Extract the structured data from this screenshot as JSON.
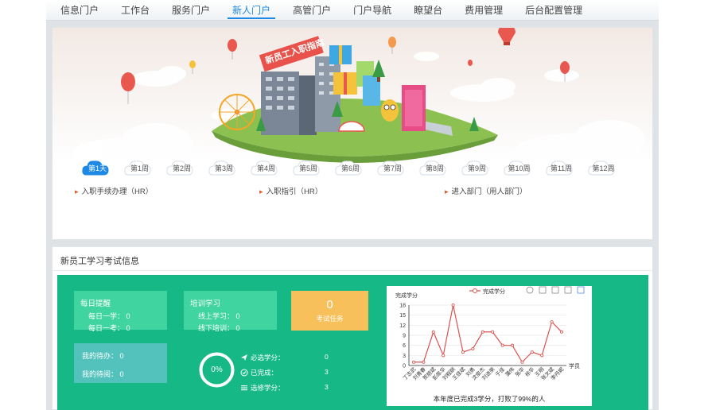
{
  "nav": {
    "items": [
      "信息门户",
      "工作台",
      "服务门户",
      "新人门户",
      "高管门户",
      "门户导航",
      "瞭望台",
      "费用管理",
      "后台配置管理"
    ],
    "active_index": 3
  },
  "banner": {
    "sign_text": "新员工入职指南"
  },
  "weeks": {
    "labels": [
      "第1天",
      "第1周",
      "第2周",
      "第3周",
      "第4周",
      "第5周",
      "第6周",
      "第7周",
      "第8周",
      "第9周",
      "第10周",
      "第11周",
      "第12周"
    ],
    "active_index": 0
  },
  "tasks": [
    "入职手续办理（HR）",
    "入职指引（HR）",
    "进入部门（用人部门）"
  ],
  "exam_panel": {
    "title": "新员工学习考试信息",
    "daily": {
      "title": "每日提醒",
      "line1": "每日一学：  0",
      "line2": "每日一考：  0"
    },
    "training": {
      "title": "培训学习",
      "line1": "线上学习：  0",
      "line2": "线下培训：  0"
    },
    "todo": {
      "line1": "我的待办：  0",
      "line2": "我的待阅：  0"
    },
    "exam_task": {
      "count": "0",
      "label": "考试任务"
    },
    "progress": {
      "percent_text": "0%",
      "fraction": 0
    },
    "credits": [
      {
        "icon": "send-icon",
        "label": "必选学分：",
        "value": "0"
      },
      {
        "icon": "check-circle-icon",
        "label": "已完成：",
        "value": "3"
      },
      {
        "icon": "list-icon",
        "label": "选修学分：",
        "value": "3"
      }
    ],
    "chart_footer": "本年度已完成3学分，打败了99%的人"
  },
  "colors": {
    "accent": "#1e88e5",
    "green_area": "#16b886",
    "card_green": "#3fd4a0",
    "card_teal": "#53c2bd",
    "card_orange": "#f8c05b",
    "line_series": "#d9534f",
    "task_arrow": "#e55a2b"
  },
  "chart_data": {
    "type": "line",
    "legend": [
      "完成学分"
    ],
    "legend_position": "top-center",
    "ylabel": "完成学分",
    "xlabel": "学员",
    "ylim": [
      0,
      18
    ],
    "yticks": [
      0,
      3,
      6,
      9,
      12,
      15,
      18
    ],
    "grid": true,
    "categories": [
      "丁志武",
      "刘青春",
      "贺朋斌",
      "彭陈华",
      "刘程颐",
      "王佳斌",
      "刘勇",
      "沈俊杰",
      "刘进荣",
      "于佳",
      "蒲伟",
      "张华",
      "徐华",
      "王明",
      "张文斌",
      "李丹妮",
      "郑宇豪",
      "李先生"
    ],
    "series": [
      {
        "name": "完成学分",
        "values": [
          1,
          1,
          10,
          3,
          18,
          4,
          5,
          10,
          10,
          6,
          6,
          1,
          4,
          3,
          13,
          10
        ]
      }
    ],
    "toolbox": [
      "refresh-icon",
      "download-icon",
      "line-chart-icon",
      "bar-chart-icon",
      "data-view-icon"
    ]
  }
}
